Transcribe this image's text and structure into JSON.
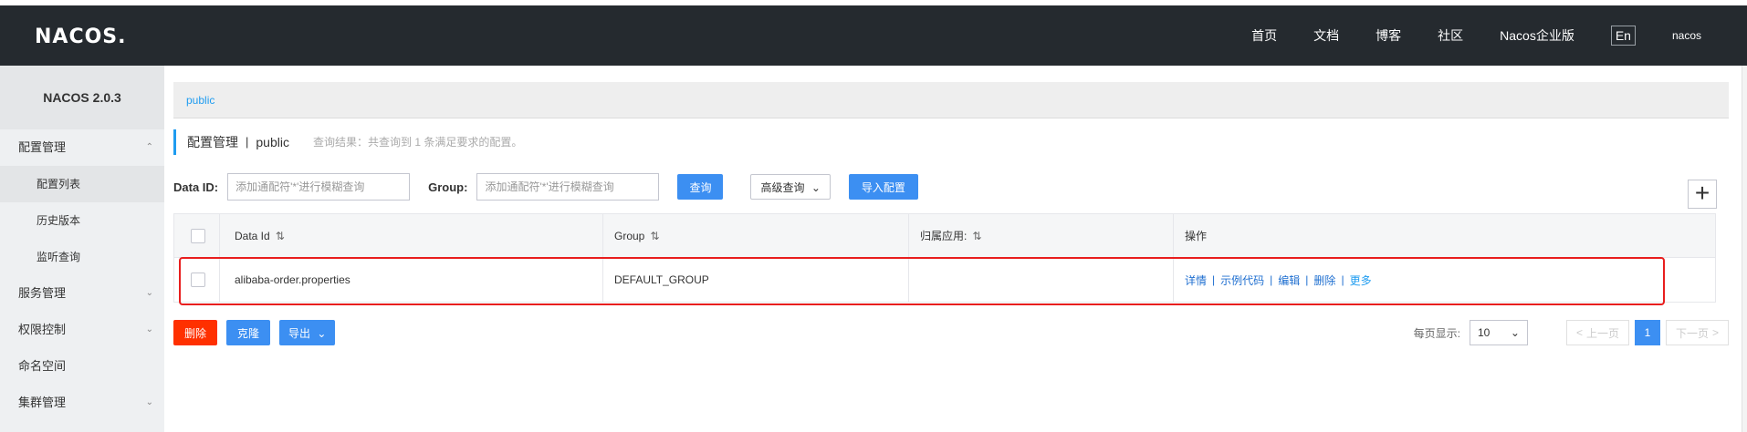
{
  "header": {
    "logo": "NACOS.",
    "nav": [
      "首页",
      "文档",
      "博客",
      "社区",
      "Nacos企业版"
    ],
    "lang": "En",
    "user": "nacos"
  },
  "sidebar": {
    "title": "NACOS 2.0.3",
    "groups": [
      {
        "label": "配置管理",
        "items": [
          "配置列表",
          "历史版本",
          "监听查询"
        ]
      },
      {
        "label": "服务管理"
      },
      {
        "label": "权限控制"
      },
      {
        "label": "命名空间"
      },
      {
        "label": "集群管理"
      }
    ]
  },
  "breadcrumb": "public",
  "page": {
    "title": "配置管理",
    "separator": "|",
    "namespace": "public",
    "result": "查询结果：共查询到 1 条满足要求的配置。"
  },
  "search": {
    "dataid_label": "Data ID:",
    "dataid_placeholder": "添加通配符'*'进行模糊查询",
    "group_label": "Group:",
    "group_placeholder": "添加通配符'*'进行模糊查询",
    "query_label": "查询",
    "advanced_label": "高级查询",
    "import_label": "导入配置"
  },
  "table": {
    "headers": [
      "Data Id",
      "Group",
      "归属应用:",
      "操作"
    ],
    "rows": [
      {
        "data_id": "alibaba-order.properties",
        "group": "DEFAULT_GROUP",
        "app": "",
        "ops": [
          "详情",
          "示例代码",
          "编辑",
          "删除",
          "更多"
        ]
      }
    ]
  },
  "bottom": {
    "delete_label": "删除",
    "clone_label": "克隆",
    "export_label": "导出",
    "per_page_label": "每页显示:",
    "per_page_value": "10",
    "prev_label": "上一页",
    "current_page": "1",
    "next_label": "下一页"
  },
  "colors": {
    "header_bg": "#252a2f",
    "primary": "#3c8ff2",
    "danger": "#ff3000",
    "highlight": "#e81e1e"
  }
}
